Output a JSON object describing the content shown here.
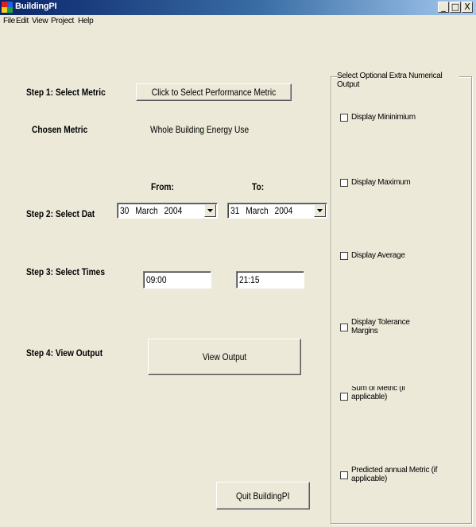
{
  "window": {
    "title": "BuildingPI",
    "minimize": "_",
    "maximize": "□",
    "close": "X"
  },
  "menu": [
    "File",
    "Edit",
    "View",
    "Project",
    "Help"
  ],
  "step1": {
    "label": "Step 1: Select Metric",
    "button": "Click to Select Performance Metric",
    "chosen_label": "Chosen Metric",
    "chosen_value": "Whole Building Energy Use"
  },
  "step2": {
    "label": "Step 2: Select Dat",
    "from_label": "From:",
    "to_label": "To:",
    "from_date": "30  March  2004",
    "to_date": "31  March  2004"
  },
  "step3": {
    "label": "Step 3: Select Times",
    "from_time": "09:00",
    "to_time": "21:15"
  },
  "step4": {
    "label": "Step 4: View Output",
    "button": "View Output"
  },
  "quit_button": "Quit BuildingPI",
  "options": {
    "title": "Select Optional Extra Numerical Output",
    "items": [
      "Display Mininimium",
      "Display Maximum",
      "Display Average",
      "Display Tolerance Margins",
      "Sum of Metric (if applicable)",
      "Predicted annual Metric (if applicable)"
    ]
  },
  "colors": {
    "titlebar_start": "#0a246a",
    "titlebar_end": "#a6caf0",
    "face": "#ece9d8"
  }
}
